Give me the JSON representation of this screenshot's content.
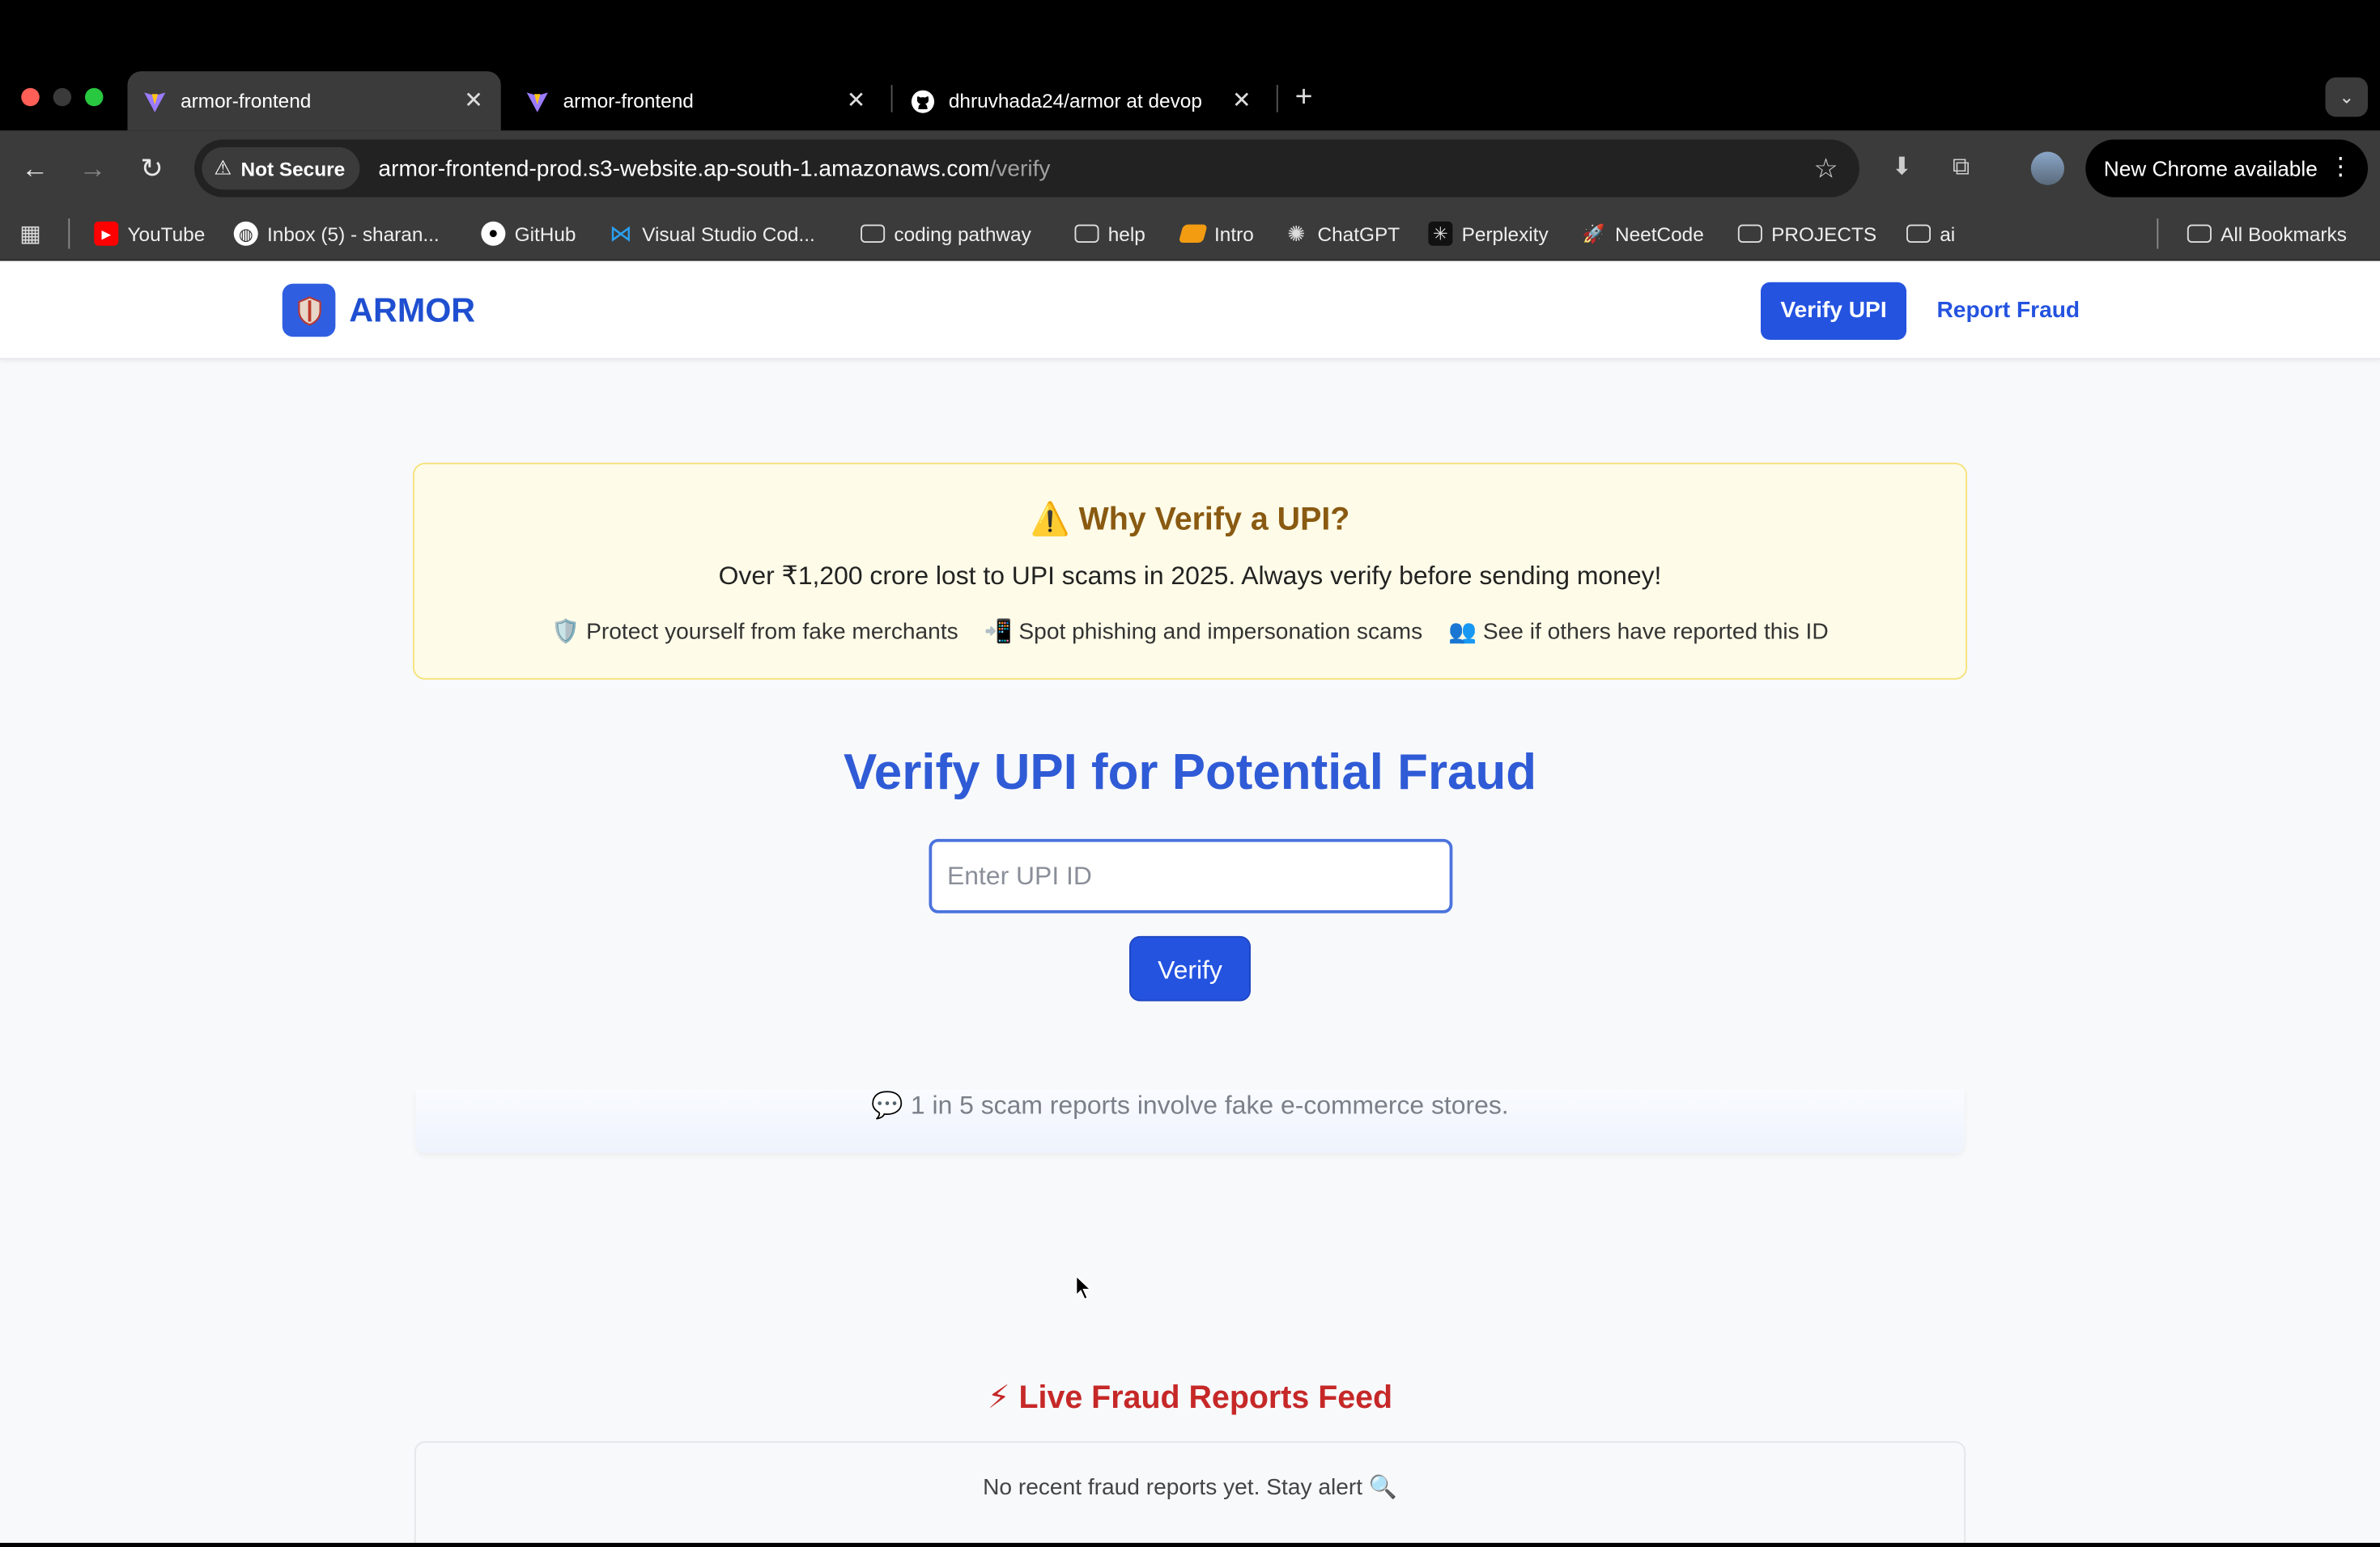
{
  "browser": {
    "tabs": [
      {
        "title": "armor-frontend",
        "active": true,
        "icon": "vite-logo-icon"
      },
      {
        "title": "armor-frontend",
        "active": false,
        "icon": "vite-logo-icon"
      },
      {
        "title": "dhruvhada24/armor at devop",
        "active": false,
        "icon": "github-icon"
      }
    ],
    "security_label": "Not Secure",
    "url_host": "armor-frontend-prod.s3-website.ap-south-1.amazonaws.com",
    "url_path": "/verify",
    "update_label": "New Chrome available",
    "bookmarks": [
      {
        "label": "YouTube",
        "icon": "youtube-icon"
      },
      {
        "label": "Inbox (5) - sharan...",
        "icon": "globe-icon"
      },
      {
        "label": "GitHub",
        "icon": "github-icon"
      },
      {
        "label": "Visual Studio Cod...",
        "icon": "vscode-icon"
      },
      {
        "label": "coding pathway",
        "icon": "folder-icon"
      },
      {
        "label": "help",
        "icon": "folder-icon"
      },
      {
        "label": "Intro",
        "icon": "bookmark-icon"
      },
      {
        "label": "ChatGPT",
        "icon": "chatgpt-icon"
      },
      {
        "label": "Perplexity",
        "icon": "perplexity-icon"
      },
      {
        "label": "NeetCode",
        "icon": "rocket-icon"
      },
      {
        "label": "PROJECTS",
        "icon": "folder-icon"
      },
      {
        "label": "ai",
        "icon": "folder-icon"
      }
    ],
    "all_bookmarks": "All Bookmarks"
  },
  "nav": {
    "brand": "ARMOR",
    "verify_label": "Verify UPI",
    "report_label": "Report Fraud"
  },
  "alert": {
    "title": "⚠️ Why Verify a UPI?",
    "subtitle": "Over ₹1,200 crore lost to UPI scams in 2025. Always verify before sending money!",
    "points": [
      "🛡️ Protect yourself from fake merchants",
      "📲 Spot phishing and impersonation scams",
      "👥 See if others have reported this ID"
    ]
  },
  "verify": {
    "heading": "Verify UPI for Potential Fraud",
    "placeholder": "Enter UPI ID",
    "button_label": "Verify"
  },
  "fact": "💬 1 in 5 scam reports involve fake e-commerce stores.",
  "feed": {
    "title": "⚡ Live Fraud Reports Feed",
    "empty_message": "No recent fraud reports yet. Stay alert 🔍"
  },
  "colors": {
    "primary": "#2453e0",
    "alert_bg": "#fefce8",
    "alert_title": "#8a5a12",
    "feed_title": "#c62828"
  }
}
